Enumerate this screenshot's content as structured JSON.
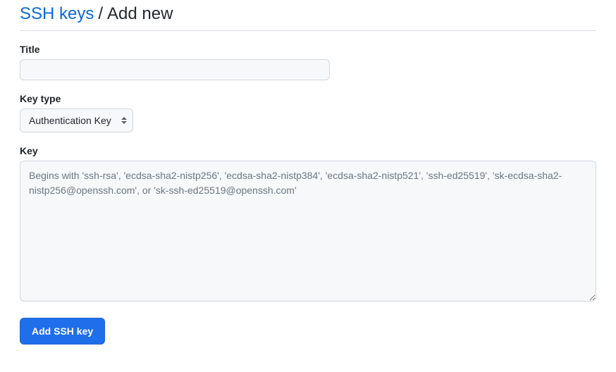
{
  "breadcrumb": {
    "parent": "SSH keys",
    "separator": "/",
    "current": "Add new"
  },
  "form": {
    "title": {
      "label": "Title",
      "value": ""
    },
    "key_type": {
      "label": "Key type",
      "selected": "Authentication Key"
    },
    "key": {
      "label": "Key",
      "value": "",
      "placeholder": "Begins with 'ssh-rsa', 'ecdsa-sha2-nistp256', 'ecdsa-sha2-nistp384', 'ecdsa-sha2-nistp521', 'ssh-ed25519', 'sk-ecdsa-sha2-nistp256@openssh.com', or 'sk-ssh-ed25519@openssh.com'"
    },
    "submit_label": "Add SSH key"
  }
}
